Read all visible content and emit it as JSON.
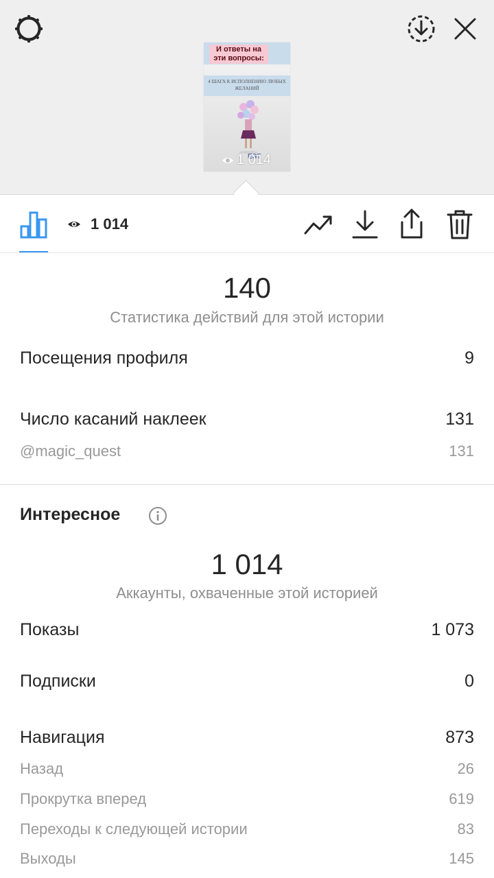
{
  "preview": {
    "title": "И ответы на эти вопросы:",
    "subtitle": "4 ШАГА К ИСПОЛНЕНИЮ ЛЮБЫХ ЖЕЛАНИЙ",
    "brand": "EST",
    "views": "1 014"
  },
  "toolbar": {
    "views": "1 014",
    "active_tab": "stats",
    "accent_color": "#3897f0"
  },
  "actions": {
    "total": "140",
    "caption": "Статистика действий для этой истории",
    "rows": [
      {
        "label": "Посещения профиля",
        "value": "9"
      },
      {
        "label": "Число касаний наклеек",
        "value": "131"
      }
    ],
    "sub_rows": [
      {
        "label": "@magic_quest",
        "value": "131"
      }
    ]
  },
  "discovery": {
    "title": "Интересное",
    "reach": "1 014",
    "reach_caption": "Аккаунты, охваченные этой историей",
    "rows": [
      {
        "label": "Показы",
        "value": "1 073"
      },
      {
        "label": "Подписки",
        "value": "0"
      },
      {
        "label": "Навигация",
        "value": "873"
      }
    ],
    "navigation": [
      {
        "label": "Назад",
        "value": "26"
      },
      {
        "label": "Прокрутка вперед",
        "value": "619"
      },
      {
        "label": "Переходы к следующей истории",
        "value": "83"
      },
      {
        "label": "Выходы",
        "value": "145"
      }
    ]
  }
}
